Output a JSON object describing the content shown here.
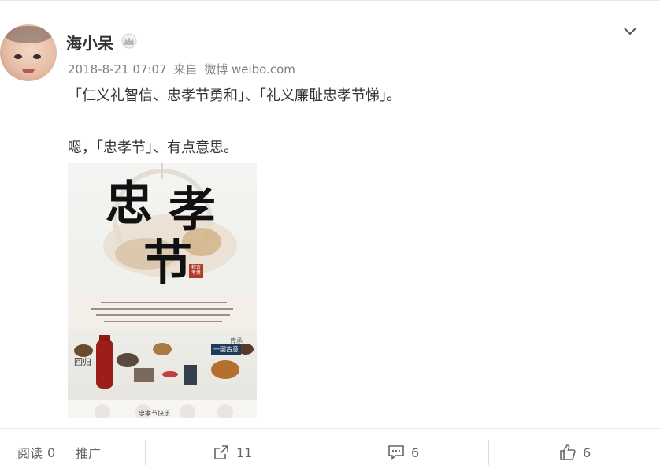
{
  "post": {
    "username": "海小呆",
    "badge_icon": "crown-icon",
    "date": "2018-8-21 07:07",
    "source_prefix": "来自",
    "source": "微博 weibo.com",
    "line1": "「仁义礼智信、忠孝节勇和」、「礼义廉耻忠孝节悌」。",
    "line2": "嗯，「忠孝节」、有点意思。"
  },
  "poster": {
    "big_chars": [
      "忠",
      "孝",
      "节"
    ],
    "seal": "释古孝意",
    "caption": "忠孝节快乐",
    "tag": "一国古意",
    "side_left": "回归",
    "side_right": "传承"
  },
  "footer": {
    "read_label": "阅读",
    "read_count": "0",
    "promote_label": "推广",
    "share_count": "11",
    "comment_count": "6",
    "like_count": "6"
  },
  "colors": {
    "accent": "#ff8200",
    "text": "#333333",
    "muted": "#808080"
  }
}
